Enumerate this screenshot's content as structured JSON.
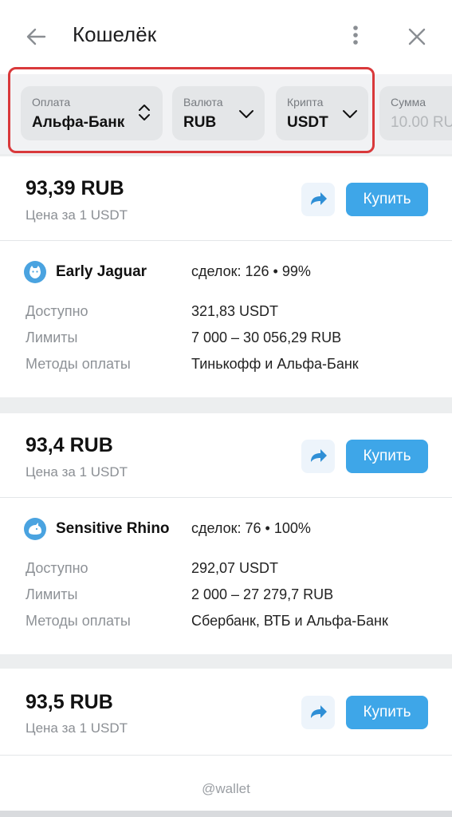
{
  "header": {
    "title": "Кошелёк",
    "icons": {
      "back": "arrow-left-icon",
      "menu": "more-vertical-icon",
      "close": "close-icon"
    }
  },
  "filters": {
    "payment": {
      "label": "Оплата",
      "value": "Альфа-Банк"
    },
    "currency": {
      "label": "Валюта",
      "value": "RUB"
    },
    "crypto": {
      "label": "Крипта",
      "value": "USDT"
    },
    "amount": {
      "label": "Сумма",
      "value": "10.00 RU"
    }
  },
  "offers": [
    {
      "price": "93,39 RUB",
      "price_sub": "Цена за 1 USDT",
      "buy_label": "Купить",
      "seller": "Early Jaguar",
      "deals": "сделок: 126 • 99%",
      "available_label": "Доступно",
      "available": "321,83 USDT",
      "limits_label": "Лимиты",
      "limits": "7 000 – 30 056,29 RUB",
      "methods_label": "Методы оплаты",
      "methods": "Тинькофф и Альфа-Банк"
    },
    {
      "price": "93,4 RUB",
      "price_sub": "Цена за 1 USDT",
      "buy_label": "Купить",
      "seller": "Sensitive Rhino",
      "deals": "сделок: 76 • 100%",
      "available_label": "Доступно",
      "available": "292,07 USDT",
      "limits_label": "Лимиты",
      "limits": "2 000 – 27 279,7 RUB",
      "methods_label": "Методы оплаты",
      "methods": "Сбербанк, ВТБ и Альфа-Банк"
    },
    {
      "price": "93,5 RUB",
      "price_sub": "Цена за 1 USDT",
      "buy_label": "Купить"
    }
  ],
  "footer": {
    "text": "@wallet"
  },
  "colors": {
    "accent": "#3ea6e8",
    "highlight": "#d9393b"
  }
}
